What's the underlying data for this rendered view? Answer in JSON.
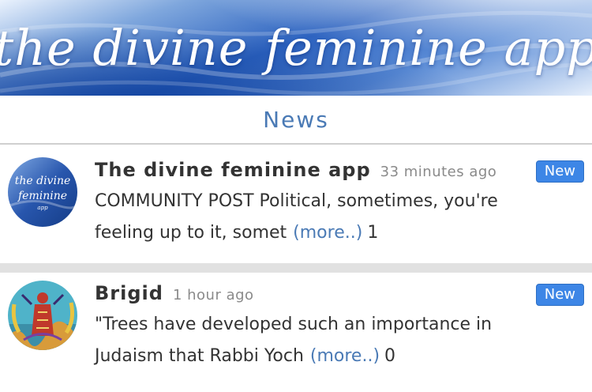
{
  "app": {
    "banner_title": "the divine feminine app"
  },
  "header": {
    "title": "News"
  },
  "avatar_logo": {
    "line1": "the divine",
    "line2": "feminine",
    "line3": "app"
  },
  "feed": [
    {
      "author": "The divine feminine app",
      "time": "33 minutes ago",
      "badge": "New",
      "text": "COMMUNITY POST Political, sometimes, you're feeling up to it, somet",
      "more": "(more..)",
      "count": "1",
      "avatar_icon": "app-logo-avatar"
    },
    {
      "author": "Brigid",
      "time": "1 hour ago",
      "badge": "New",
      "text": "\"Trees have developed such an importance in Judaism that Rabbi Yoch",
      "more": "(more..)",
      "count": "0",
      "avatar_icon": "painting-avatar"
    }
  ],
  "colors": {
    "accent": "#4a7ab5",
    "badge": "#3d86e6",
    "banner_blue": "#2d63c0"
  }
}
